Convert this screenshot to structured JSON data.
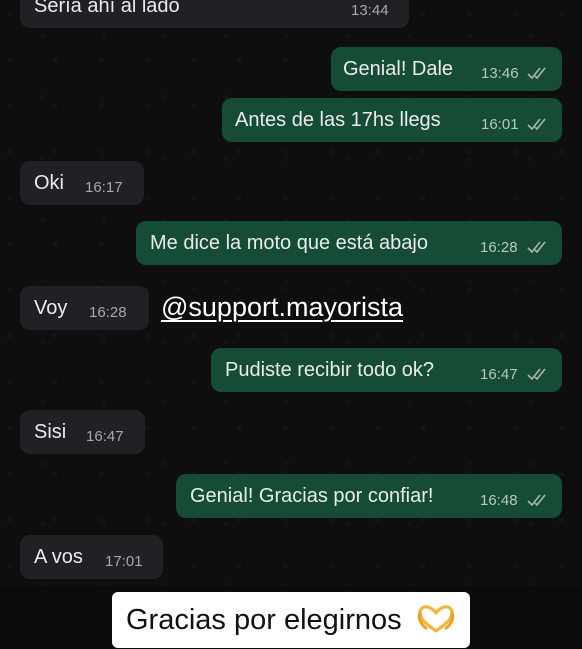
{
  "messages": [
    {
      "id": "m1",
      "dir": "in",
      "text": "Sería ahí al lado",
      "time": "13:44"
    },
    {
      "id": "m2",
      "dir": "out",
      "text": "Genial! Dale",
      "time": "13:46",
      "read": true
    },
    {
      "id": "m3",
      "dir": "out",
      "text": "Antes de las 17hs llegs",
      "time": "16:01",
      "read": true
    },
    {
      "id": "m4",
      "dir": "in",
      "text": "Oki",
      "time": "16:17"
    },
    {
      "id": "m5",
      "dir": "out",
      "text": "Me dice la moto que está abajo",
      "time": "16:28",
      "read": true
    },
    {
      "id": "m6",
      "dir": "in",
      "text": "Voy",
      "time": "16:28"
    },
    {
      "id": "m7",
      "dir": "out",
      "text": "Pudiste recibir todo ok?",
      "time": "16:47",
      "read": true
    },
    {
      "id": "m8",
      "dir": "in",
      "text": "Sisi",
      "time": "16:47"
    },
    {
      "id": "m9",
      "dir": "out",
      "text": "Genial! Gracias por confiar!",
      "time": "16:48",
      "read": true
    },
    {
      "id": "m10",
      "dir": "in",
      "text": "A vos",
      "time": "17:01"
    }
  ],
  "overlay": {
    "handle": "@support.mayorista",
    "caption": "Gracias por elegirnos",
    "caption_emoji": "heart-hands-icon"
  },
  "colors": {
    "background": "#0e0e0e",
    "incoming_bubble": "#1f2124",
    "outgoing_bubble": "#164b35",
    "tick": "#a8b8b0"
  }
}
